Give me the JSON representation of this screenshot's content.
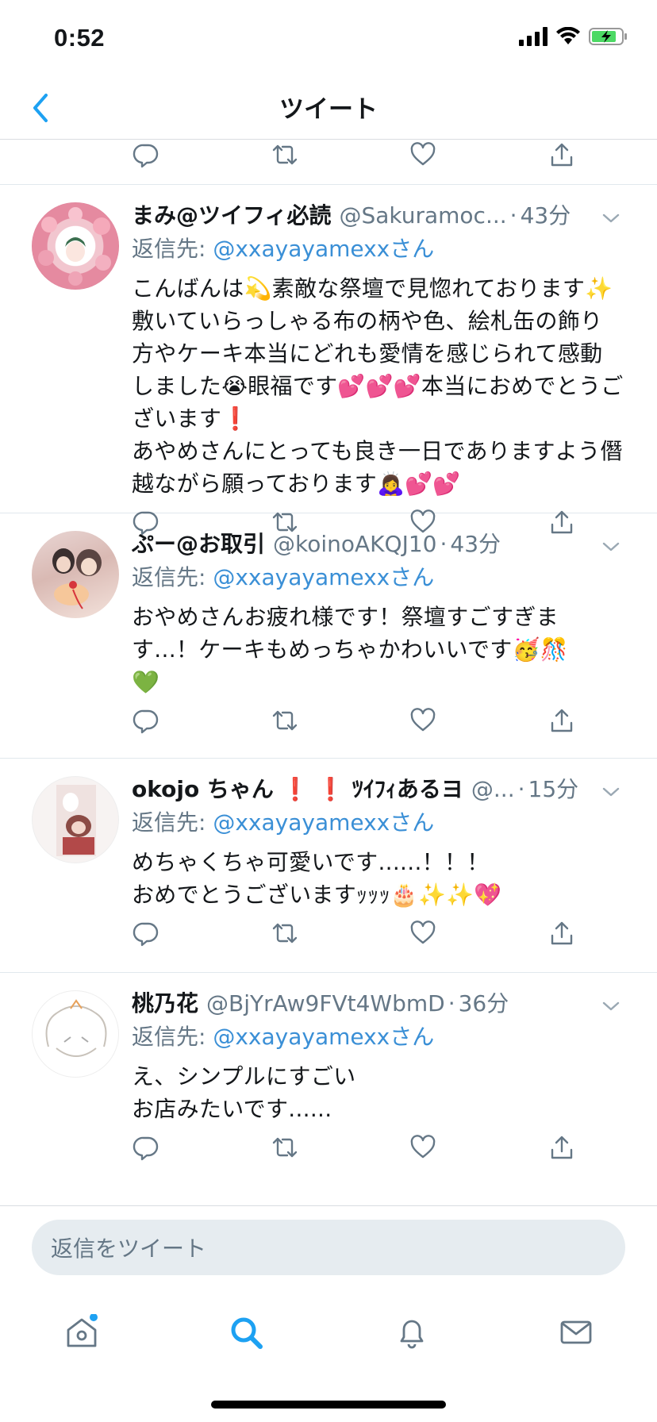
{
  "status_bar": {
    "time": "0:52"
  },
  "nav": {
    "title": "ツイート"
  },
  "tweets": [
    {
      "name": "まみ@ツイフィ必読",
      "handle": "@Sakuramoc...",
      "sep": "·",
      "time": "43分",
      "reply_prefix": "返信先: ",
      "reply_to": "@xxayayamexxさん",
      "text": "こんばんは💫素敵な祭壇で見惚れております✨敷いていらっしゃる布の柄や色、絵札缶の飾り方やケーキ本当にどれも愛情を感じられて感動しました😭眼福です💕💕💕本当におめでとうございます❗\nあやめさんにとっても良き一日でありますよう僭越ながら願っております🙇‍♀️💕💕"
    },
    {
      "name": "ぷー@お取引",
      "handle": "@koinoAKQJ10",
      "sep": "·",
      "time": "43分",
      "reply_prefix": "返信先: ",
      "reply_to": "@xxayayamexxさん",
      "text": "おやめさんお疲れ様です！祭壇すごすぎます...！ケーキもめっちゃかわいいです🥳🎊\n💚"
    },
    {
      "name": "okojo ちゃん ❗ ❗ ﾂｲﾌｨあるヨ",
      "handle": "@...",
      "sep": "·",
      "time": "15分",
      "reply_prefix": "返信先: ",
      "reply_to": "@xxayayamexxさん",
      "text": "めちゃくちゃ可愛いです......！！！\nおめでとうございますｯｯｯ🎂✨✨💖"
    },
    {
      "name": "桃乃花",
      "handle": "@BjYrAw9FVt4WbmD",
      "sep": "·",
      "time": "36分",
      "reply_prefix": "返信先: ",
      "reply_to": "@xxayayamexxさん",
      "text": "え、シンプルにすごい\nお店みたいです......"
    }
  ],
  "reply_bar": {
    "placeholder": "返信をツイート"
  },
  "tabs": [
    "home-icon",
    "search-icon",
    "notifications-icon",
    "messages-icon"
  ],
  "colors": {
    "accent": "#1da1f2",
    "mention": "#3a8fd6",
    "muted": "#657786"
  }
}
